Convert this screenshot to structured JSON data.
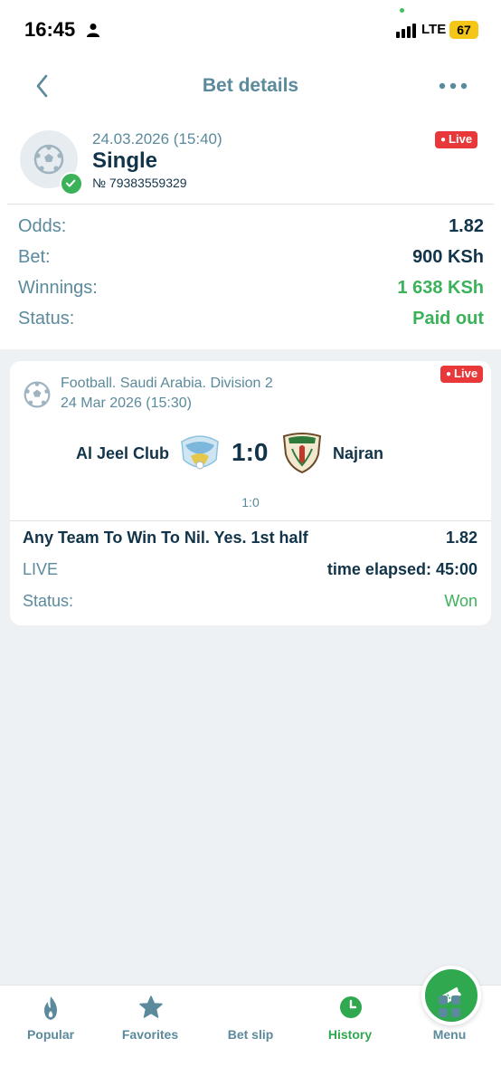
{
  "status_bar": {
    "time": "16:45",
    "network": "LTE",
    "battery": "67"
  },
  "header": {
    "title": "Bet details"
  },
  "bet": {
    "date": "24.03.2026 (15:40)",
    "type": "Single",
    "number": "№ 79383559329",
    "live_label": "Live",
    "rows": [
      {
        "key": "Odds:",
        "value": "1.82"
      },
      {
        "key": "Bet:",
        "value": "900 KSh"
      },
      {
        "key": "Winnings:",
        "value": "1 638 KSh"
      },
      {
        "key": "Status:",
        "value": "Paid out"
      }
    ]
  },
  "event": {
    "live_label": "Live",
    "league": "Football. Saudi Arabia. Division 2",
    "date": "24 Mar 2026 (15:30)",
    "team1": "Al Jeel Club",
    "team2": "Najran",
    "score": "1:0",
    "half_score": "1:0",
    "market": "Any Team To Win To Nil. Yes. 1st half",
    "odds": "1.82",
    "live_text": "LIVE",
    "time_elapsed": "time elapsed: 45:00",
    "status_key": "Status:",
    "status_value": "Won"
  },
  "tabbar": {
    "popular": "Popular",
    "favorites": "Favorites",
    "bet_slip": "Bet slip",
    "history": "History",
    "menu": "Menu"
  },
  "colors": {
    "accent_green": "#2fa84f",
    "live_red": "#e8383a",
    "muted_teal": "#5b8a9c",
    "dark_navy": "#12344a"
  }
}
